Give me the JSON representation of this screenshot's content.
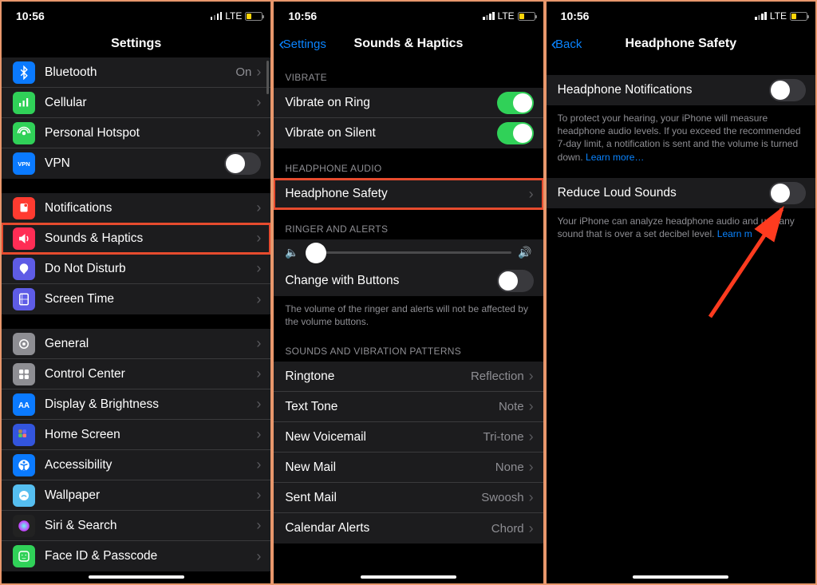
{
  "status": {
    "time": "10:56",
    "network": "LTE"
  },
  "screen1": {
    "title": "Settings",
    "rows": [
      {
        "icon": "bluetooth",
        "color": "#0a7aff",
        "label": "Bluetooth",
        "detail": "On"
      },
      {
        "icon": "cellular",
        "color": "#30d158",
        "label": "Cellular"
      },
      {
        "icon": "hotspot",
        "color": "#30d158",
        "label": "Personal Hotspot"
      },
      {
        "icon": "vpn",
        "color": "#0a7aff",
        "label": "VPN",
        "toggle": "off"
      }
    ],
    "rows2": [
      {
        "icon": "notifications",
        "color": "#ff3b30",
        "label": "Notifications"
      },
      {
        "icon": "sounds",
        "color": "#ff2d55",
        "label": "Sounds & Haptics",
        "highlight": true
      },
      {
        "icon": "dnd",
        "color": "#5e5ce6",
        "label": "Do Not Disturb"
      },
      {
        "icon": "screentime",
        "color": "#5e5ce6",
        "label": "Screen Time"
      }
    ],
    "rows3": [
      {
        "icon": "general",
        "color": "#8e8e93",
        "label": "General"
      },
      {
        "icon": "controlcenter",
        "color": "#8e8e93",
        "label": "Control Center"
      },
      {
        "icon": "display",
        "color": "#0a7aff",
        "label": "Display & Brightness"
      },
      {
        "icon": "homescreen",
        "color": "#3355dd",
        "label": "Home Screen"
      },
      {
        "icon": "accessibility",
        "color": "#0a7aff",
        "label": "Accessibility"
      },
      {
        "icon": "wallpaper",
        "color": "#55bef0",
        "label": "Wallpaper"
      },
      {
        "icon": "siri",
        "color": "#222",
        "label": "Siri & Search"
      },
      {
        "icon": "faceid",
        "color": "#30d158",
        "label": "Face ID & Passcode"
      }
    ]
  },
  "screen2": {
    "back": "Settings",
    "title": "Sounds & Haptics",
    "sections": {
      "vibrate": "Vibrate",
      "headphone": "Headphone Audio",
      "ringer": "Ringer and Alerts",
      "patterns": "Sounds and Vibration Patterns"
    },
    "vibrateRows": [
      {
        "label": "Vibrate on Ring",
        "toggle": "on"
      },
      {
        "label": "Vibrate on Silent",
        "toggle": "on"
      }
    ],
    "headphoneRow": {
      "label": "Headphone Safety",
      "highlight": true
    },
    "changeButtons": {
      "label": "Change with Buttons",
      "toggle": "off"
    },
    "ringerFootnote": "The volume of the ringer and alerts will not be affected by the volume buttons.",
    "patternRows": [
      {
        "label": "Ringtone",
        "detail": "Reflection"
      },
      {
        "label": "Text Tone",
        "detail": "Note"
      },
      {
        "label": "New Voicemail",
        "detail": "Tri-tone"
      },
      {
        "label": "New Mail",
        "detail": "None"
      },
      {
        "label": "Sent Mail",
        "detail": "Swoosh"
      },
      {
        "label": "Calendar Alerts",
        "detail": "Chord"
      }
    ]
  },
  "screen3": {
    "back": "Back",
    "title": "Headphone Safety",
    "row1": {
      "label": "Headphone Notifications",
      "toggle": "off"
    },
    "footnote1": "To protect your hearing, your iPhone will measure headphone audio levels. If you exceed the recommended 7-day limit, a notification is sent and the volume is turned down.",
    "learn": "Learn more…",
    "row2": {
      "label": "Reduce Loud Sounds",
      "toggle": "off"
    },
    "footnote2_a": "Your iPhone can analyze headphone audio and ",
    "footnote2_b": "uce any sound that is over a set decibel level.",
    "learn2": "Learn m"
  }
}
